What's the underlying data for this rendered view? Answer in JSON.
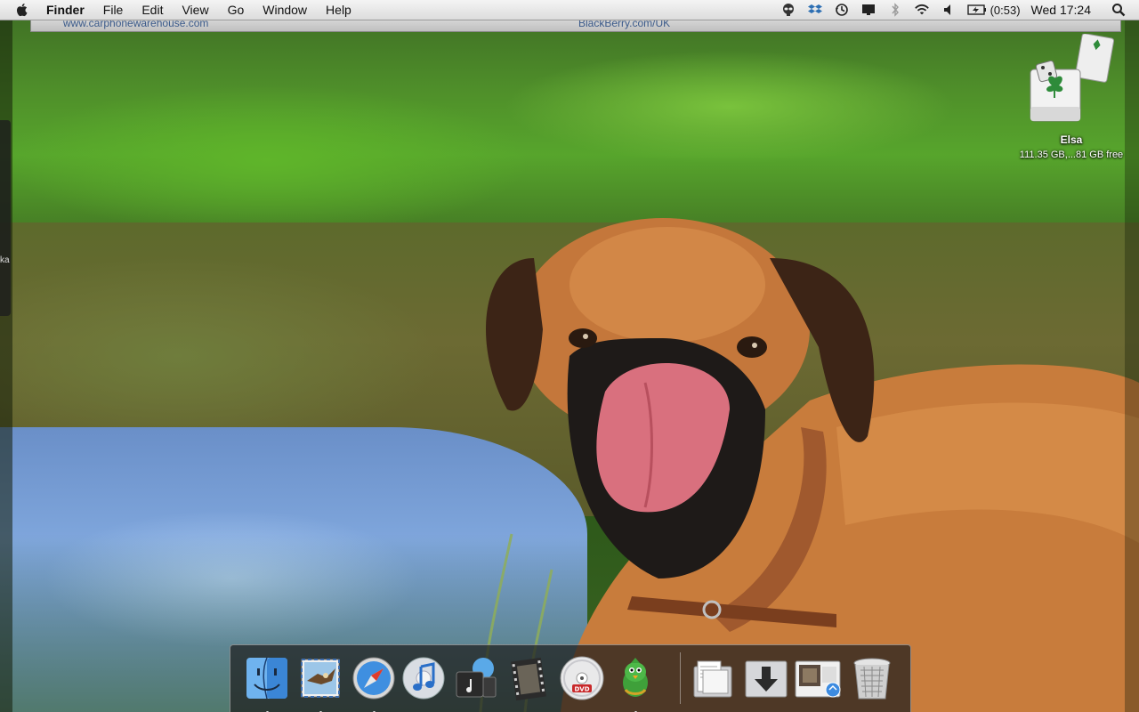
{
  "menubar": {
    "apple_icon": "apple-logo-icon",
    "app_name": "Finder",
    "menus": [
      "File",
      "Edit",
      "View",
      "Go",
      "Window",
      "Help"
    ],
    "tray_icons": [
      "alien-icon",
      "dropbox-icon",
      "time-machine-icon",
      "screen-icon",
      "bluetooth-icon",
      "wifi-icon",
      "volume-icon",
      "battery-icon"
    ],
    "battery_text": "(0:53)",
    "clock": "Wed 17:24",
    "spotlight_icon": "search-icon"
  },
  "browser_strip": {
    "left_text": "www.carphonewarehouse.com",
    "center_text": "BlackBerry.com/UK"
  },
  "side_panel": {
    "text": "ka"
  },
  "desktop_icon": {
    "name": "Elsa",
    "info": "111.35 GB,...81 GB free",
    "icon": "hard-drive-icon"
  },
  "dock": {
    "items": [
      {
        "name": "finder-icon",
        "running": true
      },
      {
        "name": "mail-icon",
        "running": true
      },
      {
        "name": "safari-icon",
        "running": true
      },
      {
        "name": "itunes-icon",
        "running": false
      },
      {
        "name": "garageband-icon",
        "running": false
      },
      {
        "name": "movie-icon",
        "running": false
      },
      {
        "name": "dvd-player-icon",
        "running": false
      },
      {
        "name": "adium-icon",
        "running": true
      },
      {
        "name": "documents-stack-icon",
        "running": false
      },
      {
        "name": "downloads-stack-icon",
        "running": false
      },
      {
        "name": "pictures-stack-icon",
        "running": false
      },
      {
        "name": "trash-icon",
        "running": false
      }
    ]
  },
  "colors": {
    "menubar": "#dcdcdc",
    "dock": "#1e1e1e"
  }
}
